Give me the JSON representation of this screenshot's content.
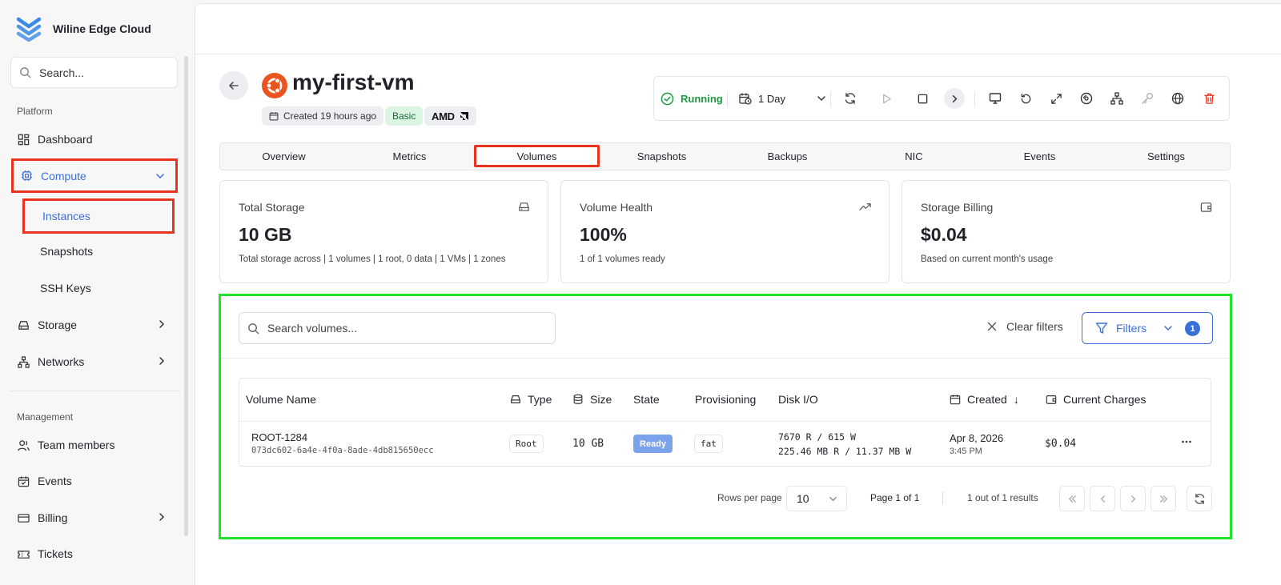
{
  "brand": {
    "name": "Wiline Edge Cloud"
  },
  "sidebar": {
    "search_placeholder": "Search...",
    "platform_label": "Platform",
    "management_label": "Management",
    "items": {
      "dashboard": "Dashboard",
      "compute": "Compute",
      "instances": "Instances",
      "snapshots": "Snapshots",
      "ssh_keys": "SSH Keys",
      "storage": "Storage",
      "networks": "Networks",
      "team_members": "Team members",
      "events": "Events",
      "billing": "Billing",
      "tickets": "Tickets"
    }
  },
  "vm": {
    "name": "my-first-vm",
    "created": "Created 19 hours ago",
    "plan": "Basic",
    "cpu_vendor": "AMD",
    "status": "Running",
    "period": "1 Day"
  },
  "tabs": [
    "Overview",
    "Metrics",
    "Volumes",
    "Snapshots",
    "Backups",
    "NIC",
    "Events",
    "Settings"
  ],
  "active_tab": "Volumes",
  "cards": [
    {
      "label": "Total Storage",
      "value": "10 GB",
      "sub": "Total storage across | 1 volumes | 1 root, 0 data | 1 VMs | 1 zones",
      "icon": "hard-drive-icon"
    },
    {
      "label": "Volume Health",
      "value": "100%",
      "sub": "1 of 1 volumes ready",
      "icon": "trending-up-icon"
    },
    {
      "label": "Storage Billing",
      "value": "$0.04",
      "sub": "Based on current month's usage",
      "icon": "wallet-icon"
    }
  ],
  "volumes": {
    "search_placeholder": "Search volumes...",
    "clear_filters": "Clear filters",
    "filters_label": "Filters",
    "filters_count": "1",
    "columns": {
      "name": "Volume Name",
      "type": "Type",
      "size": "Size",
      "state": "State",
      "provisioning": "Provisioning",
      "disk_io": "Disk I/O",
      "created": "Created",
      "created_sort": "↓",
      "charges": "Current Charges"
    },
    "rows": [
      {
        "name": "ROOT-1284",
        "id": "073dc602-6a4e-4f0a-8ade-4db815650ecc",
        "type": "Root",
        "size": "10 GB",
        "state": "Ready",
        "provisioning": "fat",
        "io_ops": "7670 R / 615 W",
        "io_bytes": "225.46 MB R / 11.37 MB W",
        "created_date": "Apr 8, 2026",
        "created_time": "3:45 PM",
        "charges": "$0.04"
      }
    ],
    "pagination": {
      "rows_per_page_label": "Rows per page",
      "rows_per_page": "10",
      "page": "Page 1 of 1",
      "results": "1 out of 1 results"
    }
  },
  "colors": {
    "accent": "#3b6fd8",
    "running": "#1b9a3e",
    "delete": "#e8341c",
    "highlight_red": "#e8341c",
    "highlight_green": "#22e32c"
  }
}
